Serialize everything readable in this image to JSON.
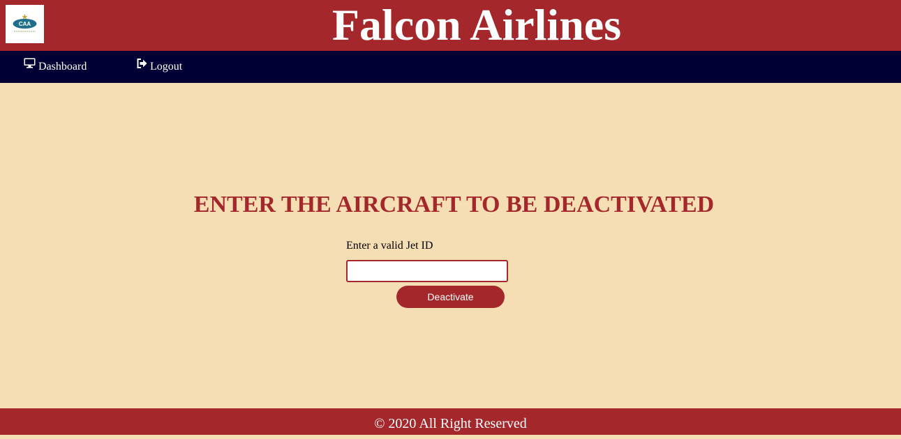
{
  "header": {
    "title": "Falcon Airlines",
    "logo_text": "CAA"
  },
  "nav": {
    "items": [
      {
        "label": "Dashboard",
        "icon": "monitor-icon"
      },
      {
        "label": "Logout",
        "icon": "sign-out-icon"
      }
    ]
  },
  "main": {
    "heading": "ENTER THE AIRCRAFT TO BE DEACTIVATED",
    "field_label": "Enter a valid Jet ID",
    "jet_id_value": "",
    "button_label": "Deactivate"
  },
  "footer": {
    "text": "© 2020 All Right Reserved"
  },
  "colors": {
    "header_bg": "#a4282b",
    "nav_bg": "#000035",
    "page_bg": "#f5deb3",
    "accent": "#a4282b"
  }
}
